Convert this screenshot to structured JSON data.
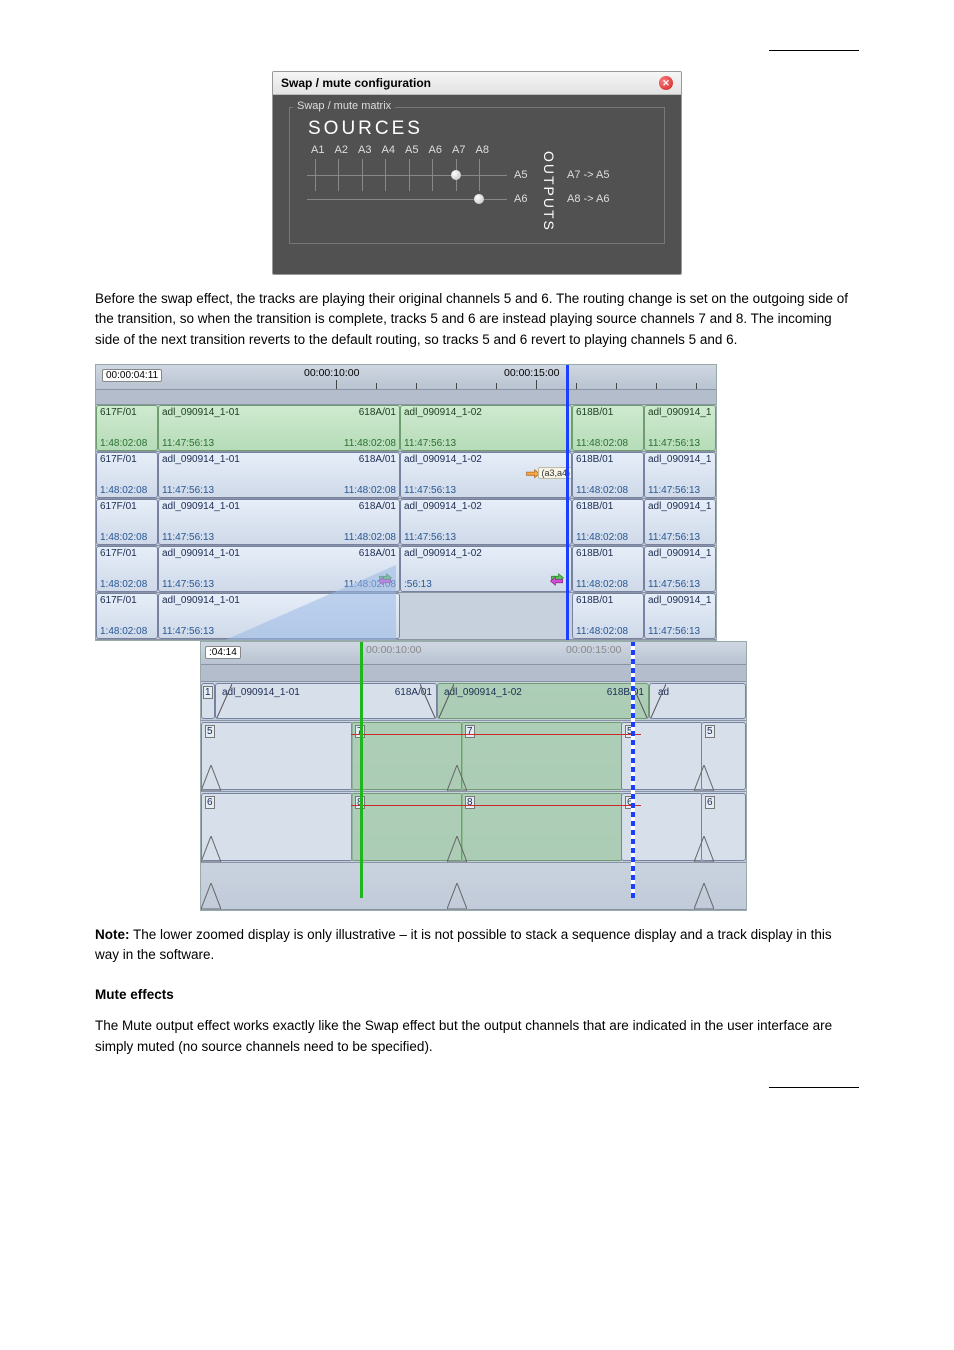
{
  "swap": {
    "window_title": "Swap / mute configuration",
    "fieldset": "Swap / mute matrix",
    "sources_title": "SOURCES",
    "outputs_title": "OUTPUTS",
    "src_labels": [
      "A1",
      "A2",
      "A3",
      "A4",
      "A5",
      "A6",
      "A7",
      "A8"
    ],
    "out_a5": "A5",
    "out_a6": "A6",
    "map1": "A7  -> A5",
    "map2": "A8  -> A6"
  },
  "para_swap": "Before the swap effect, the tracks are playing their original channels 5 and 6. The routing change is set on the outgoing side of the transition, so when the transition is complete, tracks 5 and 6 are instead playing source channels 7 and 8. The incoming side of the next transition reverts to the default routing, so tracks 5 and 6 revert to playing channels 5 and 6.",
  "note_label": "Note:",
  "note_text": "The lower zoomed display is only illustrative – it is not possible to stack a sequence display and a track display in this way in the software.",
  "hdr_mute": "Mute effects",
  "para_mute": "The Mute output effect works exactly like the Swap effect but the output channels that are indicated in the user interface are simply muted (no source channels need to be specified).",
  "ruler_top": {
    "current_tc": "00:00:04:11",
    "t10": "00:00:10:00",
    "t15": "00:00:15:00"
  },
  "ruler_low": {
    "current_tc": ":04:14",
    "t10": "00:00:10:00",
    "t15": "00:00:15:00"
  },
  "clips": {
    "c1_left_a": "617F/01",
    "c1_left_b": "adl_090914_1-01",
    "c1_left_tc_a": "1:48:02:08",
    "c1_left_tc_b": "11:47:56:13",
    "c1_mid_a": "618A/01",
    "c1_mid_b": "adl_090914_1-02",
    "c1_mid_tc_a": "11:48:02:08",
    "c1_mid_tc_b": "11:47:56:13",
    "c1_right_a": "618B/01",
    "c1_right_b": "adl_090914_1",
    "c1_right_tc_a": "11:48:02:08",
    "c1_right_tc_b": "11:47:56:13",
    "tag": "(a3,a4)"
  },
  "lower": {
    "clipA": "adl_090914_1-01",
    "clipA_r": "618A/01",
    "clipB": "adl_090914_1-02",
    "clipB_r": "618B/01",
    "clipC": "ad",
    "n1": "1",
    "n5": "5",
    "n6": "6",
    "n7": "7",
    "n8": "8"
  }
}
